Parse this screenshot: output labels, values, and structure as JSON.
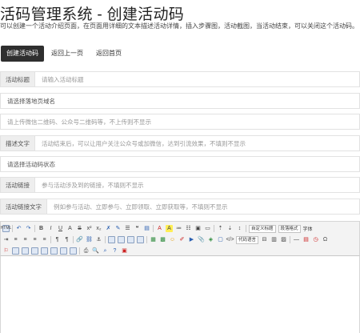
{
  "header": {
    "title": "活码管理系统 - 创建活动码",
    "description": "可以创建一个活动介绍页面，在页面用详细的文本描述活动详情，插入步骤图，活动截图，当活动结束，可以关闭这个活动码。"
  },
  "actions": {
    "create_label": "创建活动码",
    "back_label": "返回上一页",
    "home_label": "返回首页"
  },
  "form": {
    "title_addon": "活动标题",
    "title_placeholder": "请输入活动标题",
    "domain_select": "请选择落地页域名",
    "qrcode_placeholder": "请上传微信二维码、公众号二维码等，不上传则不显示",
    "desc_addon": "描述文字",
    "desc_placeholder": "活动结束后，可以让用户关注公众号或加微信，达到引流效果，不填则不显示",
    "status_select": "请选择活动码状态",
    "link_addon": "活动链接",
    "link_placeholder": "参与活动涉及到的链接，不填则不显示",
    "link_text_addon": "活动链接文字",
    "link_text_placeholder": "例如参与活动、立即参与、立即领取、立即获取等，不填则不显示"
  },
  "editor": {
    "html_label": "HTML",
    "custom_title_select": "自定义标题",
    "paragraph_select": "段落格式",
    "font_select": "字体",
    "code_lang_select": "代码语言"
  }
}
